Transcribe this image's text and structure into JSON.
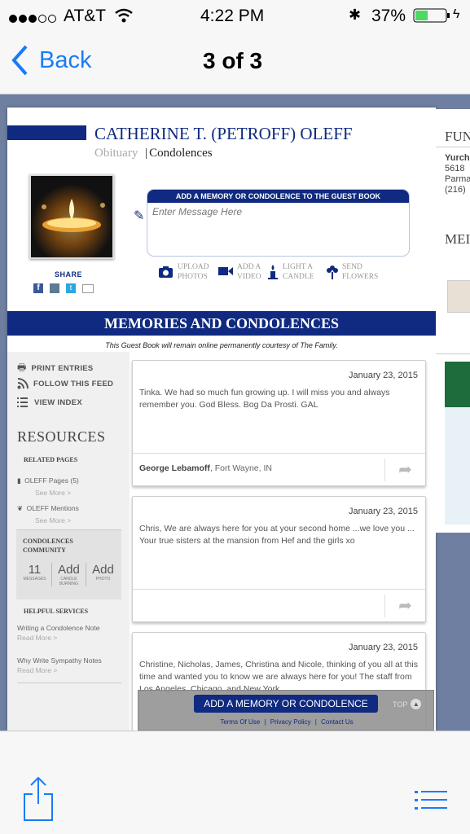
{
  "status_bar": {
    "carrier": "AT&T",
    "time": "4:22 PM",
    "battery": "37%"
  },
  "nav": {
    "back_label": "Back",
    "title": "3 of 3"
  },
  "obituary": {
    "name": "CATHERINE T. (PETROFF) OLEFF",
    "tab_obituary": "Obituary",
    "tab_separator": "|",
    "tab_condolences": "Condolences",
    "share_label": "SHARE",
    "guestbook_header": "ADD A MEMORY OR CONDOLENCE TO THE GUEST BOOK",
    "message_placeholder": "Enter Message Here",
    "actions": [
      {
        "label_line1": "UPLOAD",
        "label_line2": "PHOTOS"
      },
      {
        "label_line1": "ADD A",
        "label_line2": "VIDEO"
      },
      {
        "label_line1": "LIGHT A",
        "label_line2": "CANDLE"
      },
      {
        "label_line1": "SEND",
        "label_line2": "FLOWERS"
      }
    ],
    "banner": "MEMORIES AND CONDOLENCES",
    "courtesy": "This Guest Book will remain online permanently courtesy of The Family."
  },
  "sidebar": {
    "links": [
      "PRINT ENTRIES",
      "FOLLOW THIS FEED",
      "VIEW INDEX"
    ],
    "resources_heading": "RESOURCES",
    "related_heading": "RELATED PAGES",
    "related": [
      {
        "label": "OLEFF Pages (5)",
        "more": "See More >"
      },
      {
        "label": "OLEFF Mentions",
        "more": "See More >"
      }
    ],
    "community_heading_line1": "CONDOLENCES",
    "community_heading_line2": "COMMUNITY",
    "community_stats": [
      {
        "value": "11",
        "label_line1": "MESSAGES",
        "label_line2": ""
      },
      {
        "value": "Add",
        "label_line1": "CANDLE",
        "label_line2": "BURNING"
      },
      {
        "value": "Add",
        "label_line1": "PHOTO",
        "label_line2": ""
      }
    ],
    "helpful_heading": "HELPFUL SERVICES",
    "helpful": [
      {
        "label": "Writing a Condolence Note",
        "more": "Read More >"
      },
      {
        "label": "Why Write Sympathy Notes",
        "more": "Read More >"
      }
    ]
  },
  "entries": [
    {
      "date": "January 23, 2015",
      "message": "Tinka. We had so much fun growing up. I will miss you and always remember you. God Bless. Bog Da Prosti. GAL",
      "author": "George Lebamoff",
      "location": ", Fort Wayne, IN"
    },
    {
      "date": "January 23, 2015",
      "message": "Chris, We are always here for you at your second home ...we love you ... Your true sisters at the mansion from Hef and the girls xo",
      "author": "",
      "location": ""
    },
    {
      "date": "January 23, 2015",
      "message": "Christine, Nicholas, James, Christina and Nicole, thinking of you all at this time and wanted you to know we are always here for you! The staff from Los Angeles, Chicago, and New York",
      "author": "",
      "location": ""
    }
  ],
  "sticky": {
    "add_button": "ADD A MEMORY OR CONDOLENCE",
    "top_label": "TOP",
    "footer_links": [
      "Terms Of Use",
      "Privacy Policy",
      "Contact Us"
    ],
    "separator": "|"
  },
  "next_page": {
    "heading": "FUN",
    "lines": [
      "Yurch",
      "5618",
      "Parma",
      "(216)"
    ],
    "heading2": "MEI",
    "ad_text": "G\nC",
    "ad_text2": "D\n»"
  },
  "colors": {
    "brand_navy": "#0f2a80",
    "ios_blue": "#1a7cf5",
    "viewer_bg": "#6e7fa1"
  }
}
